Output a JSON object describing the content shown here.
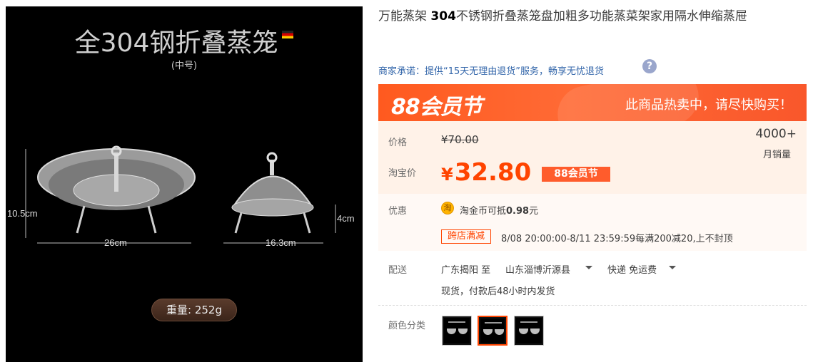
{
  "image": {
    "title": "全304钢折叠蒸笼",
    "subtitle": "(中号)",
    "dim_height_left": "10.5cm",
    "dim_width_left": "26cm",
    "dim_width_right": "16.3cm",
    "dim_height_right": "4cm",
    "weight": "重量: 252g"
  },
  "product": {
    "title_prefix": "万能蒸架 ",
    "title_bold": "304",
    "title_rest": "不锈钢折叠蒸笼盘加粗多功能蒸菜架家用隔水伸缩蒸屉"
  },
  "promise": {
    "text": "商家承诺：提供“15天无理由退货”服务，畅享无忧退货",
    "help_icon": "?"
  },
  "banner": {
    "left": "88会员节",
    "right": "此商品热卖中，请尽快购买！"
  },
  "price": {
    "price_label": "价格",
    "original": "¥70.00",
    "taobao_label": "淘宝价",
    "currency": "¥",
    "current": "32.80",
    "event_tag": "88会员节",
    "sales_count": "4000+",
    "sales_label": "月销量"
  },
  "promo": {
    "label": "优惠",
    "coin_icon": "淘",
    "coin_text": "淘金币可抵",
    "coin_value": "0.98",
    "coin_unit": "元",
    "shop_tag": "跨店满减",
    "shop_text": "8/08 20:00:00-8/11 23:59:59每满200减20,上不封顶"
  },
  "shipping": {
    "label": "配送",
    "from": "广东揭阳 至",
    "to": "山东淄博沂源县",
    "method": "快递 免运费",
    "note": "现货，付款后48小时内发货"
  },
  "color": {
    "label": "颜色分类",
    "selected_index": 1
  },
  "colors": {
    "accent": "#ff4400",
    "banner": "#ff5a1f",
    "link": "#3366aa"
  }
}
